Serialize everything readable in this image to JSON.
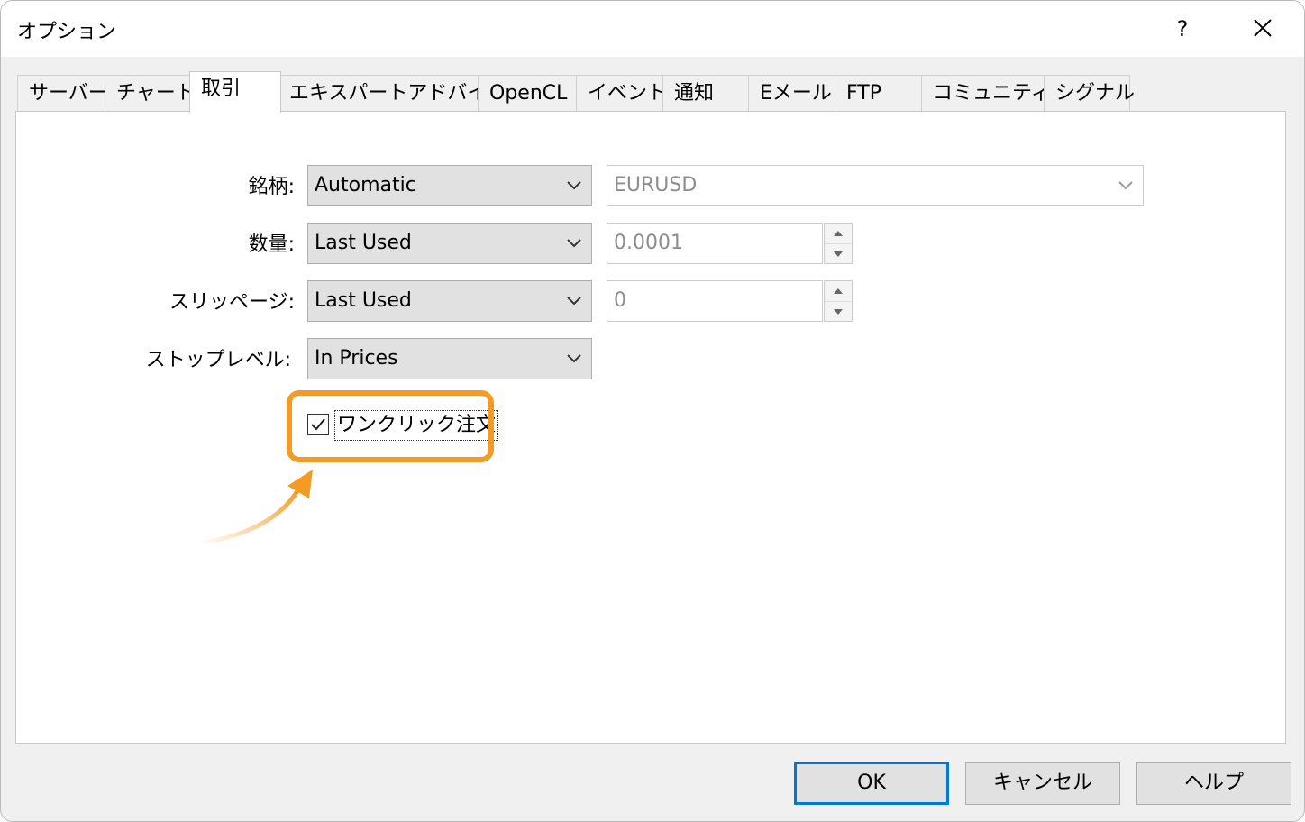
{
  "window": {
    "title": "オプション",
    "help_label": "?"
  },
  "tabs": [
    {
      "label": "サーバー"
    },
    {
      "label": "チャート"
    },
    {
      "label": "取引",
      "active": true
    },
    {
      "label": "エキスパートアドバイザ"
    },
    {
      "label": "OpenCL"
    },
    {
      "label": "イベント"
    },
    {
      "label": "通知"
    },
    {
      "label": "Eメール"
    },
    {
      "label": "FTP"
    },
    {
      "label": "コミュニティー"
    },
    {
      "label": "シグナル"
    }
  ],
  "trade": {
    "symbol": {
      "label": "銘柄:",
      "mode": "Automatic",
      "value": "EURUSD"
    },
    "volume": {
      "label": "数量:",
      "mode": "Last Used",
      "value": "0.0001"
    },
    "slippage": {
      "label": "スリッページ:",
      "mode": "Last Used",
      "value": "0"
    },
    "stop_level": {
      "label": "ストップレベル:",
      "mode": "In Prices"
    },
    "one_click": {
      "label": "ワンクリック注文",
      "checked": true
    }
  },
  "buttons": {
    "ok": "OK",
    "cancel": "キャンセル",
    "help": "ヘルプ"
  },
  "colors": {
    "highlight": "#f39b24",
    "default_button_border": "#0078d7"
  },
  "icons": {
    "close": "close-icon",
    "dropdown": "chevron-down-icon",
    "spin_up": "arrow-up-icon",
    "spin_down": "arrow-down-icon",
    "check": "check-icon",
    "annotation": "curved-arrow-icon"
  }
}
